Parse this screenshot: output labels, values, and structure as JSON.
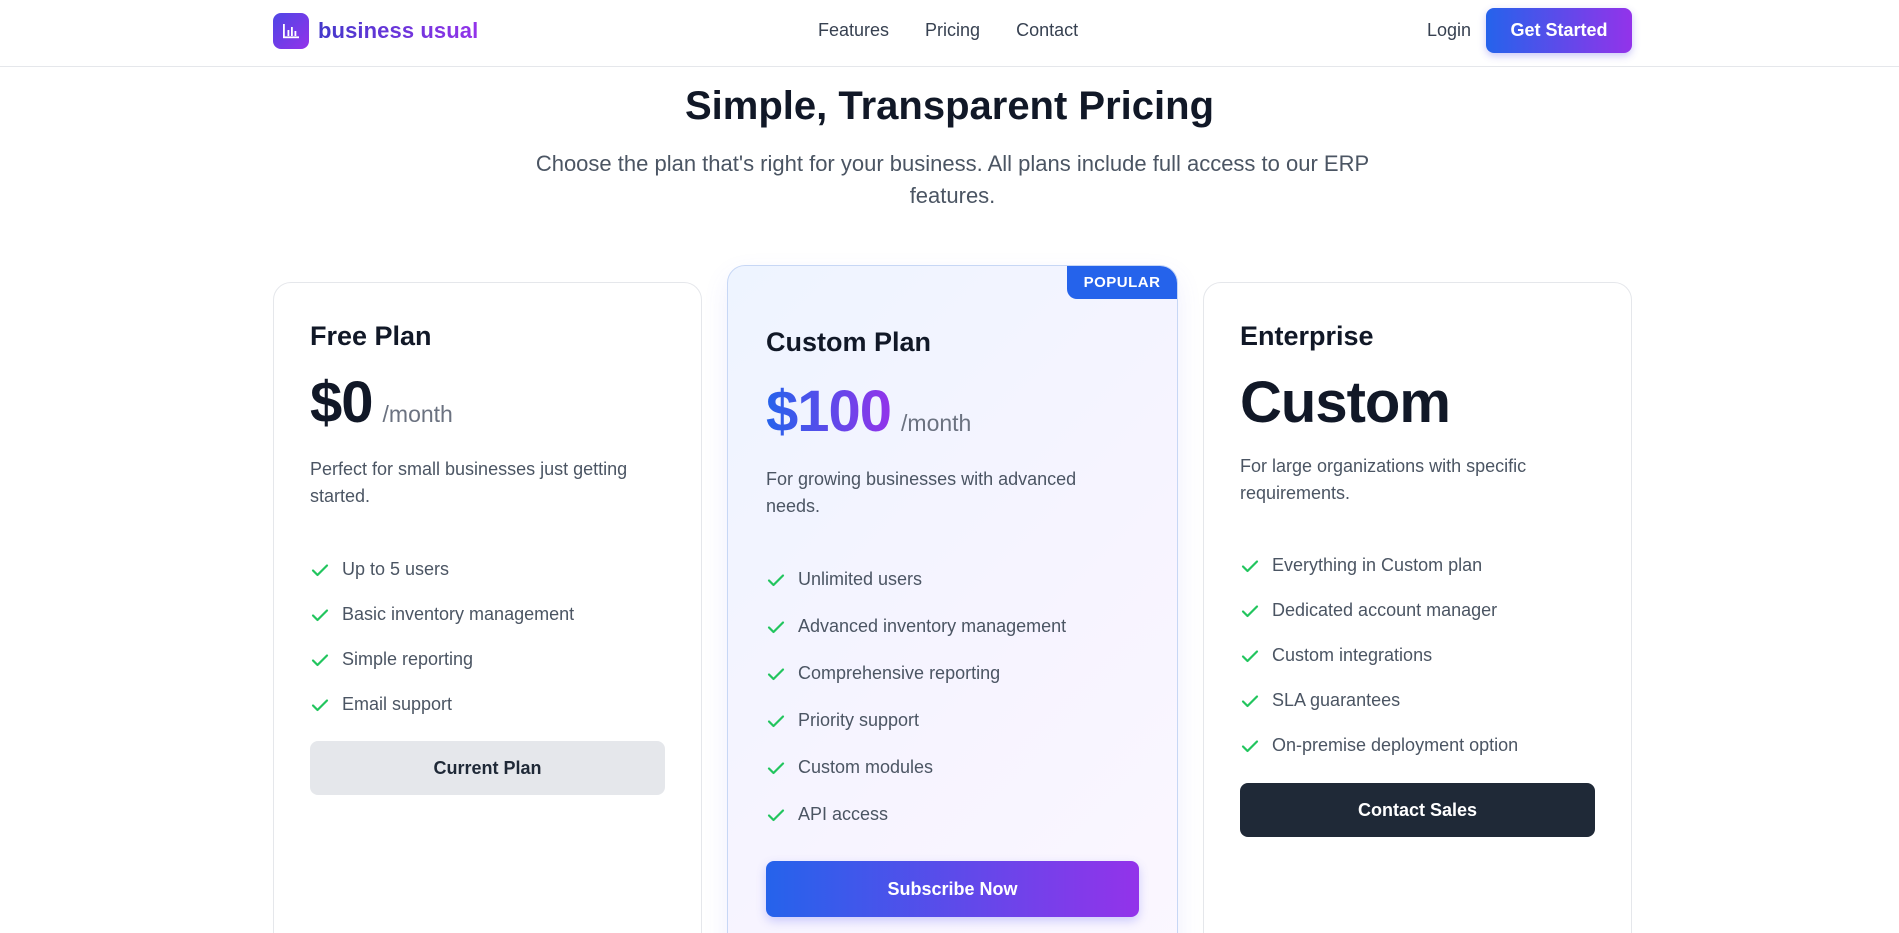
{
  "header": {
    "brand": "business usual",
    "logo_icon": "bar-chart-icon",
    "nav": [
      "Features",
      "Pricing",
      "Contact"
    ],
    "login": "Login",
    "cta": "Get Started"
  },
  "hero": {
    "title": "Simple, Transparent Pricing",
    "subtitle": "Choose the plan that's right for your business. All plans include full access to our ERP features."
  },
  "plans": [
    {
      "name": "Free Plan",
      "price": "$0",
      "period": "/month",
      "description": "Perfect for small businesses just getting started.",
      "features": [
        "Up to 5 users",
        "Basic inventory management",
        "Simple reporting",
        "Email support"
      ],
      "button": "Current Plan"
    },
    {
      "badge": "POPULAR",
      "name": "Custom Plan",
      "price": "$100",
      "period": "/month",
      "description": "For growing businesses with advanced needs.",
      "features": [
        "Unlimited users",
        "Advanced inventory management",
        "Comprehensive reporting",
        "Priority support",
        "Custom modules",
        "API access"
      ],
      "button": "Subscribe Now"
    },
    {
      "name": "Enterprise",
      "price": "Custom",
      "description": "For large organizations with specific requirements.",
      "features": [
        "Everything in Custom plan",
        "Dedicated account manager",
        "Custom integrations",
        "SLA guarantees",
        "On-premise deployment option"
      ],
      "button": "Contact Sales"
    }
  ],
  "colors": {
    "accent_start": "#2563eb",
    "accent_end": "#9333ea",
    "check": "#22c55e",
    "dark_button": "#1f2937"
  }
}
